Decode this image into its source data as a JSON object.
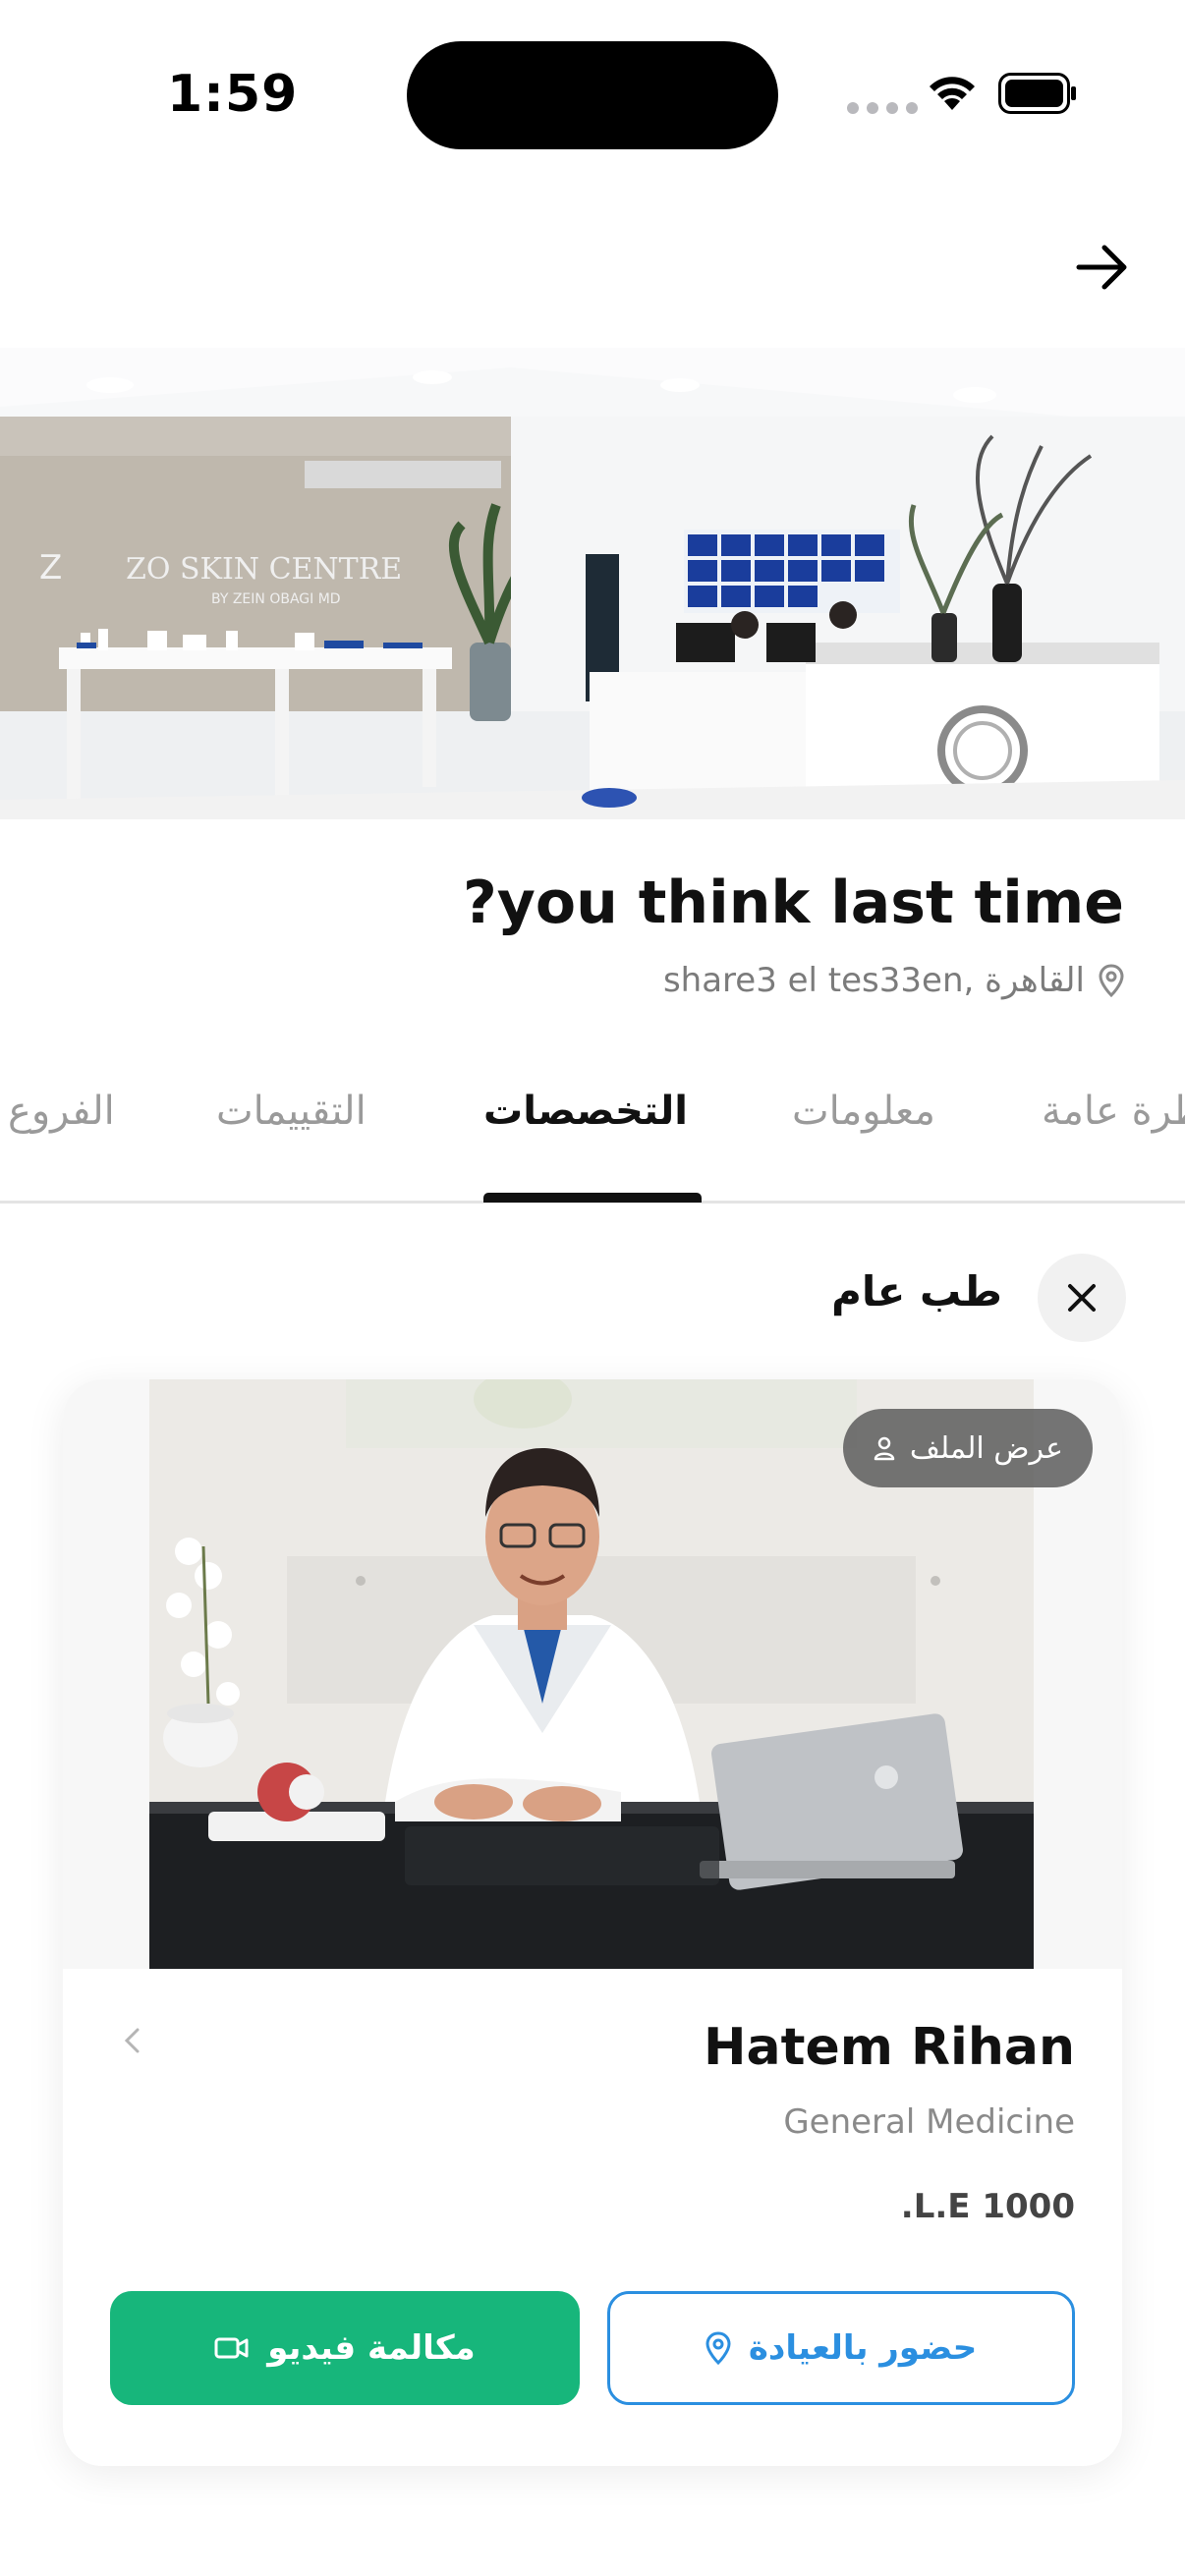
{
  "status_bar": {
    "time": "1:59"
  },
  "clinic": {
    "title": "?you think last time",
    "location": "share3 el tes33en, القاهرة"
  },
  "tabs": [
    {
      "label": "الفروع"
    },
    {
      "label": "التقييمات"
    },
    {
      "label": "التخصصات"
    },
    {
      "label": "معلومات"
    },
    {
      "label": "نظرة عامة"
    }
  ],
  "active_tab": "التخصصات",
  "filter": {
    "label": "طب عام"
  },
  "doctor": {
    "view_profile": "عرض الملف",
    "name": "Hatem Rihan",
    "specialty": "General Medicine",
    "price": ".L.E 1000",
    "clinic_visit_label": "حضور بالعيادة",
    "video_call_label": "مكالمة فيديو"
  },
  "colors": {
    "accent_blue": "#2b8fe0",
    "accent_green": "#17b67b"
  }
}
